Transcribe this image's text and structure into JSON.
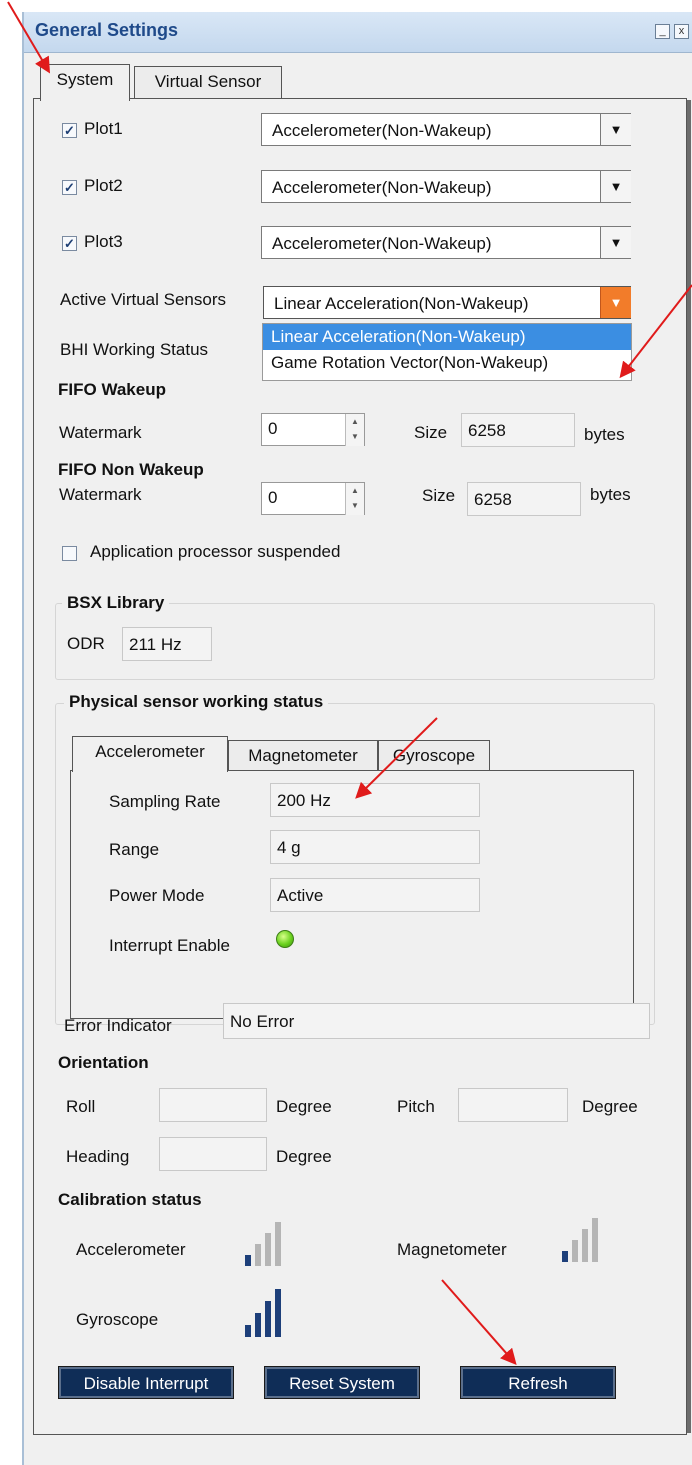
{
  "window": {
    "title": "General Settings",
    "minimize_glyph": "_",
    "close_glyph": "x"
  },
  "tabs": [
    {
      "label": "System",
      "active": true
    },
    {
      "label": "Virtual Sensor",
      "active": false
    }
  ],
  "plots": [
    {
      "label": "Plot1",
      "checked": true,
      "value": "Accelerometer(Non-Wakeup)"
    },
    {
      "label": "Plot2",
      "checked": true,
      "value": "Accelerometer(Non-Wakeup)"
    },
    {
      "label": "Plot3",
      "checked": true,
      "value": "Accelerometer(Non-Wakeup)"
    }
  ],
  "active_virtual_sensors": {
    "label": "Active Virtual Sensors",
    "value": "Linear Acceleration(Non-Wakeup)",
    "options": [
      "Linear Acceleration(Non-Wakeup)",
      "Game Rotation Vector(Non-Wakeup)"
    ]
  },
  "bhi_working_status": {
    "label": "BHI Working Status"
  },
  "fifo_wakeup": {
    "heading": "FIFO Wakeup",
    "watermark_label": "Watermark",
    "watermark_value": "0",
    "size_label": "Size",
    "size_value": "6258",
    "unit": "bytes"
  },
  "fifo_non_wakeup": {
    "heading": "FIFO Non Wakeup",
    "watermark_label": "Watermark",
    "watermark_value": "0",
    "size_label": "Size",
    "size_value": "6258",
    "unit": "bytes"
  },
  "ap_suspended": {
    "label": "Application processor suspended",
    "checked": false
  },
  "bsx_library": {
    "heading": "BSX Library",
    "odr_label": "ODR",
    "odr_value": "211 Hz"
  },
  "physical_sensor": {
    "heading": "Physical sensor working status",
    "tabs": [
      {
        "label": "Accelerometer",
        "active": true
      },
      {
        "label": "Magnetometer",
        "active": false
      },
      {
        "label": "Gyroscope",
        "active": false
      }
    ],
    "sampling_rate_label": "Sampling Rate",
    "sampling_rate_value": "200 Hz",
    "range_label": "Range",
    "range_value": "4 g",
    "power_mode_label": "Power Mode",
    "power_mode_value": "Active",
    "interrupt_label": "Interrupt Enable",
    "interrupt_color": "#6bd11f"
  },
  "error_indicator": {
    "label": "Error Indicator",
    "value": "No Error"
  },
  "orientation": {
    "heading": "Orientation",
    "roll_label": "Roll",
    "pitch_label": "Pitch",
    "heading_label": "Heading",
    "unit": "Degree"
  },
  "calibration": {
    "heading": "Calibration status",
    "accelerometer_label": "Accelerometer",
    "accelerometer_level": 1,
    "magnetometer_label": "Magnetometer",
    "magnetometer_level": 1,
    "gyroscope_label": "Gyroscope",
    "gyroscope_level": 4,
    "level_max": 4
  },
  "buttons": {
    "disable_interrupt": "Disable Interrupt",
    "reset_system": "Reset System",
    "refresh": "Refresh"
  },
  "colors": {
    "accent": "#1f4a8a",
    "button_bg": "#0f2d57",
    "annotation_arrow": "#e01b1b"
  }
}
